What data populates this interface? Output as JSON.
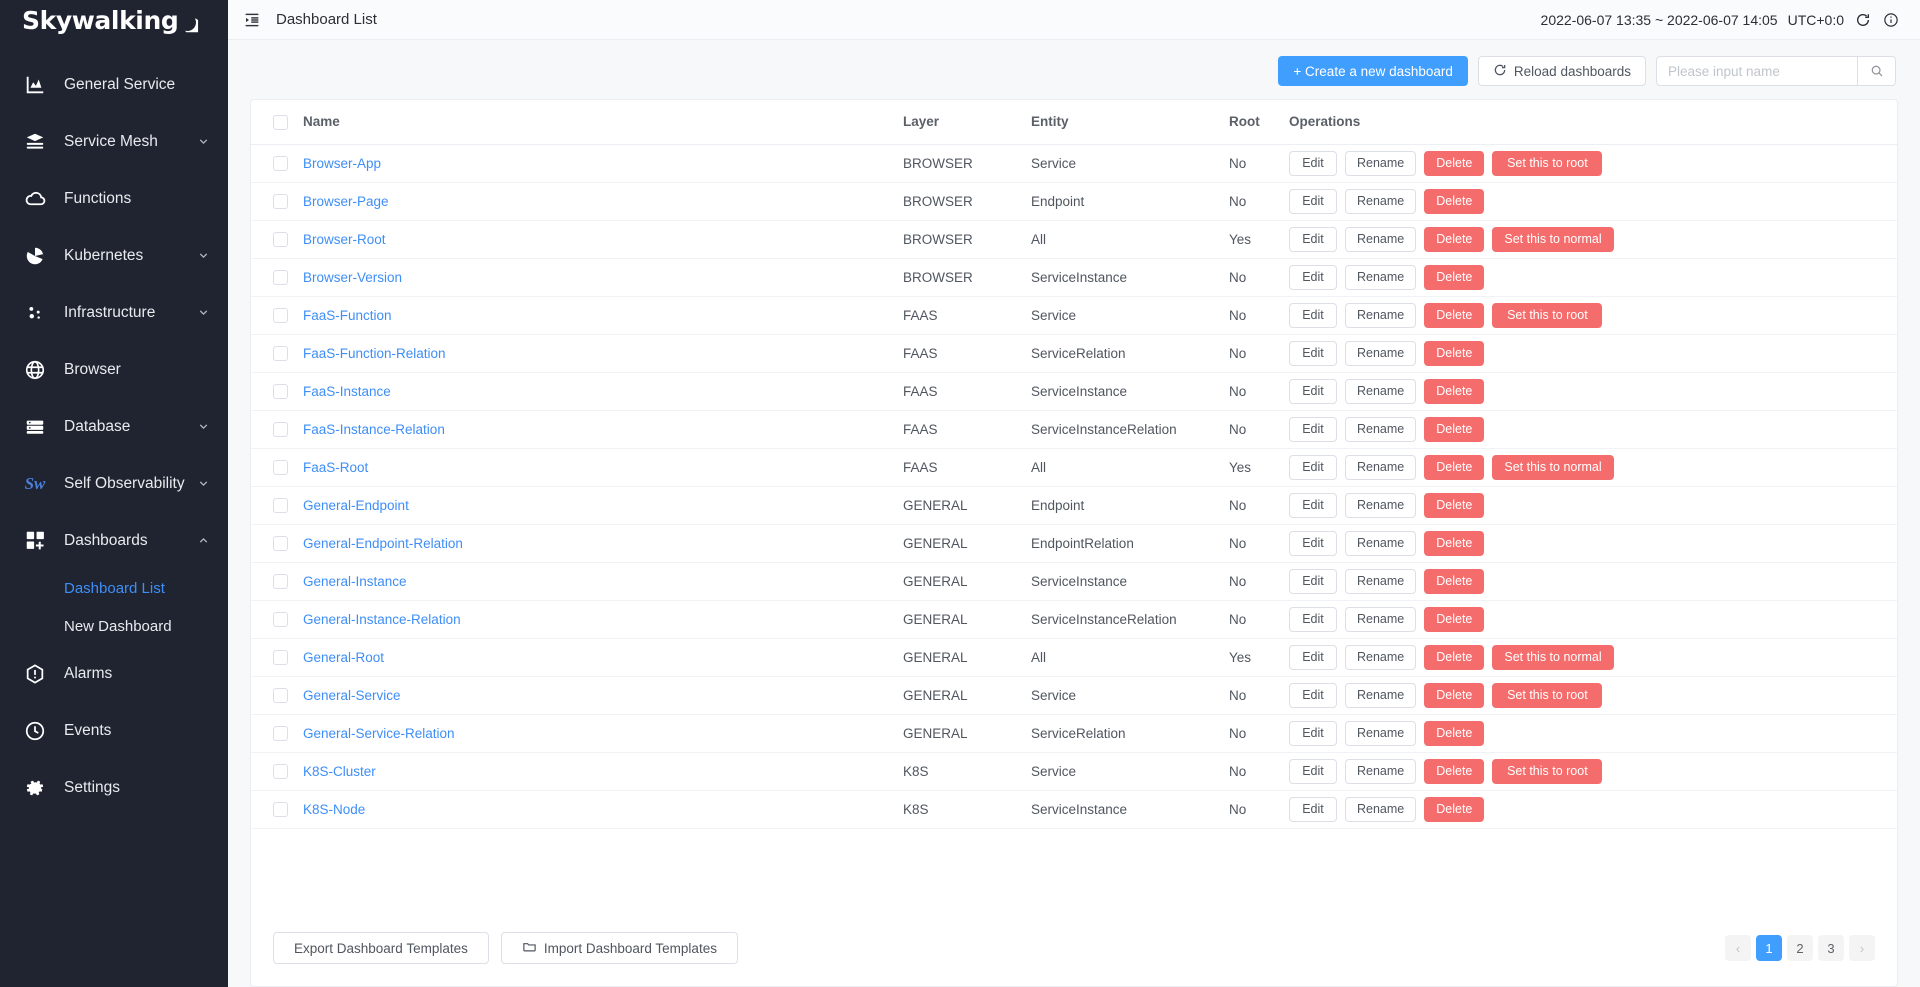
{
  "brand": {
    "name": "Skywalking",
    "moon_icon": "crescent-moon-icon"
  },
  "sidebar": {
    "items": [
      {
        "label": "General Service",
        "icon": "chart-bar-icon",
        "expandable": false,
        "expanded": false
      },
      {
        "label": "Service Mesh",
        "icon": "layers-icon",
        "expandable": true,
        "expanded": false
      },
      {
        "label": "Functions",
        "icon": "cloud-icon",
        "expandable": false,
        "expanded": false
      },
      {
        "label": "Kubernetes",
        "icon": "kubernetes-pie-icon",
        "expandable": true,
        "expanded": false
      },
      {
        "label": "Infrastructure",
        "icon": "nodes-icon",
        "expandable": true,
        "expanded": false
      },
      {
        "label": "Browser",
        "icon": "globe-icon",
        "expandable": false,
        "expanded": false
      },
      {
        "label": "Database",
        "icon": "database-icon",
        "expandable": true,
        "expanded": false
      },
      {
        "label": "Self Observability",
        "icon": "sw-logo-icon",
        "expandable": true,
        "expanded": false
      },
      {
        "label": "Dashboards",
        "icon": "dashboard-grid-icon",
        "expandable": true,
        "expanded": true
      },
      {
        "label": "Alarms",
        "icon": "alert-hexagon-icon",
        "expandable": false,
        "expanded": false
      },
      {
        "label": "Events",
        "icon": "clock-icon",
        "expandable": false,
        "expanded": false
      },
      {
        "label": "Settings",
        "icon": "gear-icon",
        "expandable": false,
        "expanded": false
      }
    ],
    "dashboards_children": [
      {
        "label": "Dashboard List",
        "active": true
      },
      {
        "label": "New Dashboard",
        "active": false
      }
    ],
    "active_color": "#3e8ef7"
  },
  "topbar": {
    "collapse_icon": "collapse-sidebar-icon",
    "title": "Dashboard List",
    "time_range": "2022-06-07 13:35 ~ 2022-06-07 14:05",
    "timezone": "UTC+0:0",
    "reload_icon": "refresh-icon",
    "info_icon": "info-circle-icon"
  },
  "toolbar": {
    "create_label": "+ Create a new dashboard",
    "reload_label": "Reload dashboards",
    "reload_icon": "refresh-icon",
    "search_placeholder": "Please input name",
    "search_value": "",
    "search_icon": "search-icon",
    "primary_color": "#409eff"
  },
  "table": {
    "columns": [
      "Name",
      "Layer",
      "Entity",
      "Root",
      "Operations"
    ],
    "select_all_checked": false,
    "ops_labels": {
      "edit": "Edit",
      "rename": "Rename",
      "delete": "Delete",
      "set_root": "Set this to root",
      "set_normal": "Set this to normal"
    },
    "danger_color": "#f56c6c",
    "rows": [
      {
        "name": "Browser-App",
        "layer": "BROWSER",
        "entity": "Service",
        "root": "No",
        "root_action": "Set this to root"
      },
      {
        "name": "Browser-Page",
        "layer": "BROWSER",
        "entity": "Endpoint",
        "root": "No",
        "root_action": ""
      },
      {
        "name": "Browser-Root",
        "layer": "BROWSER",
        "entity": "All",
        "root": "Yes",
        "root_action": "Set this to normal"
      },
      {
        "name": "Browser-Version",
        "layer": "BROWSER",
        "entity": "ServiceInstance",
        "root": "No",
        "root_action": ""
      },
      {
        "name": "FaaS-Function",
        "layer": "FAAS",
        "entity": "Service",
        "root": "No",
        "root_action": "Set this to root"
      },
      {
        "name": "FaaS-Function-Relation",
        "layer": "FAAS",
        "entity": "ServiceRelation",
        "root": "No",
        "root_action": ""
      },
      {
        "name": "FaaS-Instance",
        "layer": "FAAS",
        "entity": "ServiceInstance",
        "root": "No",
        "root_action": ""
      },
      {
        "name": "FaaS-Instance-Relation",
        "layer": "FAAS",
        "entity": "ServiceInstanceRelation",
        "root": "No",
        "root_action": ""
      },
      {
        "name": "FaaS-Root",
        "layer": "FAAS",
        "entity": "All",
        "root": "Yes",
        "root_action": "Set this to normal"
      },
      {
        "name": "General-Endpoint",
        "layer": "GENERAL",
        "entity": "Endpoint",
        "root": "No",
        "root_action": ""
      },
      {
        "name": "General-Endpoint-Relation",
        "layer": "GENERAL",
        "entity": "EndpointRelation",
        "root": "No",
        "root_action": ""
      },
      {
        "name": "General-Instance",
        "layer": "GENERAL",
        "entity": "ServiceInstance",
        "root": "No",
        "root_action": ""
      },
      {
        "name": "General-Instance-Relation",
        "layer": "GENERAL",
        "entity": "ServiceInstanceRelation",
        "root": "No",
        "root_action": ""
      },
      {
        "name": "General-Root",
        "layer": "GENERAL",
        "entity": "All",
        "root": "Yes",
        "root_action": "Set this to normal"
      },
      {
        "name": "General-Service",
        "layer": "GENERAL",
        "entity": "Service",
        "root": "No",
        "root_action": "Set this to root"
      },
      {
        "name": "General-Service-Relation",
        "layer": "GENERAL",
        "entity": "ServiceRelation",
        "root": "No",
        "root_action": ""
      },
      {
        "name": "K8S-Cluster",
        "layer": "K8S",
        "entity": "Service",
        "root": "No",
        "root_action": "Set this to root"
      },
      {
        "name": "K8S-Node",
        "layer": "K8S",
        "entity": "ServiceInstance",
        "root": "No",
        "root_action": ""
      }
    ]
  },
  "footer": {
    "export_label": "Export Dashboard Templates",
    "import_label": "Import Dashboard Templates",
    "import_icon": "folder-icon",
    "pagination": {
      "prev": "‹",
      "next": "›",
      "pages": [
        "1",
        "2",
        "3"
      ],
      "current": "1"
    }
  }
}
